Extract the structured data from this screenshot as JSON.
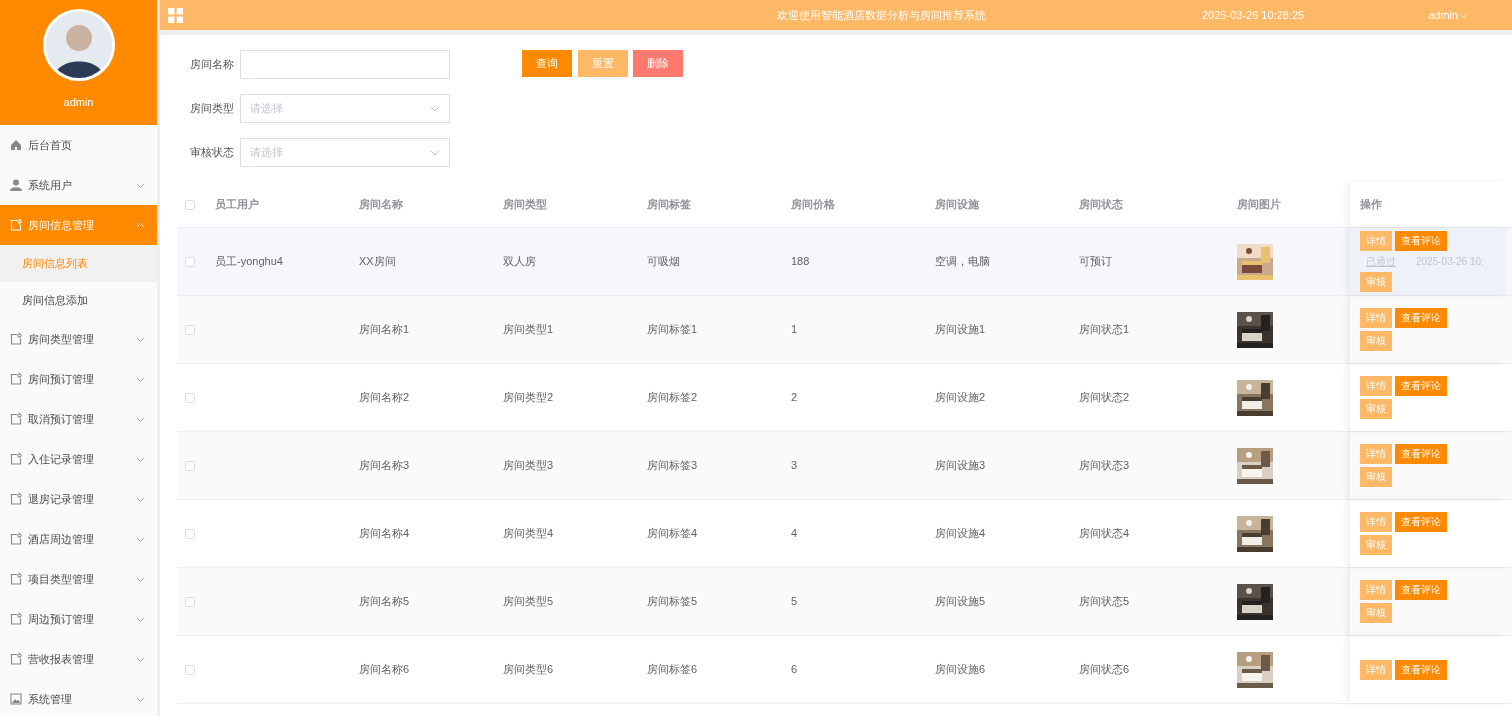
{
  "header": {
    "title": "欢迎使用智能酒店数据分析与房间推荐系统",
    "datetime": "2025-03-26 10:28:25",
    "user": "admin"
  },
  "sidebar": {
    "username": "admin",
    "items": [
      {
        "label": "后台首页",
        "kind": "home",
        "selected": false
      },
      {
        "label": "系统用户",
        "kind": "user",
        "expanded": false,
        "selected": false
      },
      {
        "label": "房间信息管理",
        "kind": "module",
        "expanded": true,
        "selected": true,
        "children": [
          {
            "label": "房间信息列表",
            "selected": true
          },
          {
            "label": "房间信息添加",
            "selected": false
          }
        ]
      },
      {
        "label": "房间类型管理",
        "kind": "module",
        "expanded": false,
        "selected": false
      },
      {
        "label": "房间预订管理",
        "kind": "module",
        "expanded": false,
        "selected": false
      },
      {
        "label": "取消预订管理",
        "kind": "module",
        "expanded": false,
        "selected": false
      },
      {
        "label": "入住记录管理",
        "kind": "module",
        "expanded": false,
        "selected": false
      },
      {
        "label": "退房记录管理",
        "kind": "module",
        "expanded": false,
        "selected": false
      },
      {
        "label": "酒店周边管理",
        "kind": "module",
        "expanded": false,
        "selected": false
      },
      {
        "label": "项目类型管理",
        "kind": "module",
        "expanded": false,
        "selected": false
      },
      {
        "label": "周边预订管理",
        "kind": "module",
        "expanded": false,
        "selected": false
      },
      {
        "label": "营收报表管理",
        "kind": "module",
        "expanded": false,
        "selected": false
      },
      {
        "label": "系统管理",
        "kind": "settings",
        "expanded": false,
        "selected": false
      }
    ]
  },
  "search": {
    "fields": [
      {
        "label": "房间名称",
        "kind": "text"
      },
      {
        "label": "房间类型",
        "kind": "select",
        "placeholder": "请选择"
      },
      {
        "label": "审核状态",
        "kind": "select",
        "placeholder": "请选择"
      }
    ],
    "buttons": [
      {
        "label": "查询",
        "kind": "primary"
      },
      {
        "label": "重置",
        "kind": "light"
      },
      {
        "label": "删除",
        "kind": "danger"
      }
    ]
  },
  "table": {
    "select_all_checked": false,
    "columns": [
      "员工用户",
      "房间名称",
      "房间类型",
      "房间标签",
      "房间价格",
      "房间设施",
      "房间状态",
      "房间图片",
      "操作"
    ],
    "rows": [
      {
        "checked": false,
        "highlighted": true,
        "cells": [
          "员工-yonghu4",
          "XX房间",
          "双人房",
          "可吸烟",
          "188",
          "空调，电脑",
          "可预订"
        ],
        "behind": [
          "已通过",
          "2025-03-26 10:"
        ],
        "actions": [
          {
            "label": "详情",
            "kind": "light"
          },
          {
            "label": "查看评论",
            "kind": "primary"
          },
          {
            "label": "审核",
            "kind": "light"
          }
        ]
      },
      {
        "checked": false,
        "highlighted": false,
        "cells": [
          "",
          "房间名称1",
          "房间类型1",
          "房间标签1",
          "1",
          "房间设施1",
          "房间状态1"
        ],
        "actions": [
          {
            "label": "详情",
            "kind": "light"
          },
          {
            "label": "查看评论",
            "kind": "primary"
          },
          {
            "label": "审核",
            "kind": "light"
          }
        ]
      },
      {
        "checked": false,
        "highlighted": false,
        "cells": [
          "",
          "房间名称2",
          "房间类型2",
          "房间标签2",
          "2",
          "房间设施2",
          "房间状态2"
        ],
        "actions": [
          {
            "label": "详情",
            "kind": "light"
          },
          {
            "label": "查看评论",
            "kind": "primary"
          },
          {
            "label": "审核",
            "kind": "light"
          }
        ]
      },
      {
        "checked": false,
        "highlighted": false,
        "cells": [
          "",
          "房间名称3",
          "房间类型3",
          "房间标签3",
          "3",
          "房间设施3",
          "房间状态3"
        ],
        "actions": [
          {
            "label": "详情",
            "kind": "light"
          },
          {
            "label": "查看评论",
            "kind": "primary"
          },
          {
            "label": "审核",
            "kind": "light"
          }
        ]
      },
      {
        "checked": false,
        "highlighted": false,
        "cells": [
          "",
          "房间名称4",
          "房间类型4",
          "房间标签4",
          "4",
          "房间设施4",
          "房间状态4"
        ],
        "actions": [
          {
            "label": "详情",
            "kind": "light"
          },
          {
            "label": "查看评论",
            "kind": "primary"
          },
          {
            "label": "审核",
            "kind": "light"
          }
        ]
      },
      {
        "checked": false,
        "highlighted": false,
        "cells": [
          "",
          "房间名称5",
          "房间类型5",
          "房间标签5",
          "5",
          "房间设施5",
          "房间状态5"
        ],
        "actions": [
          {
            "label": "详情",
            "kind": "light"
          },
          {
            "label": "查看评论",
            "kind": "primary"
          },
          {
            "label": "审核",
            "kind": "light"
          }
        ]
      },
      {
        "checked": false,
        "highlighted": false,
        "cells": [
          "",
          "房间名称6",
          "房间类型6",
          "房间标签6",
          "6",
          "房间设施6",
          "房间状态6"
        ],
        "actions": [
          {
            "label": "详情",
            "kind": "light"
          },
          {
            "label": "查看评论",
            "kind": "primary"
          }
        ]
      }
    ]
  }
}
